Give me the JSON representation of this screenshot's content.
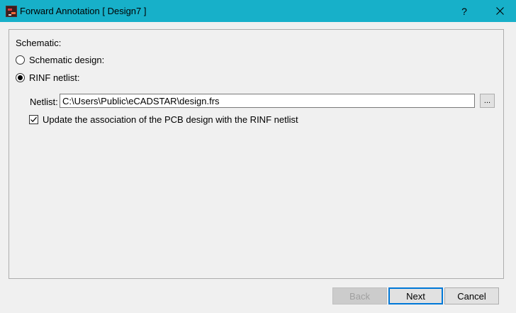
{
  "window": {
    "title": "Forward Annotation [ Design7 ]",
    "help_label": "?",
    "close_label": "✕",
    "icon": "ecadstar-app-icon"
  },
  "schematic": {
    "group_label": "Schematic:",
    "options": [
      {
        "label": "Schematic design:",
        "selected": false
      },
      {
        "label": "RINF netlist:",
        "selected": true
      }
    ]
  },
  "netlist": {
    "label": "Netlist:",
    "value": "C:\\Users\\Public\\eCADSTAR\\design.frs",
    "browse_label": "...",
    "update_association_label": "Update the association of the PCB design with the RINF netlist",
    "update_association_checked": true
  },
  "buttons": {
    "back_label": "Back",
    "next_label": "Next",
    "cancel_label": "Cancel"
  }
}
